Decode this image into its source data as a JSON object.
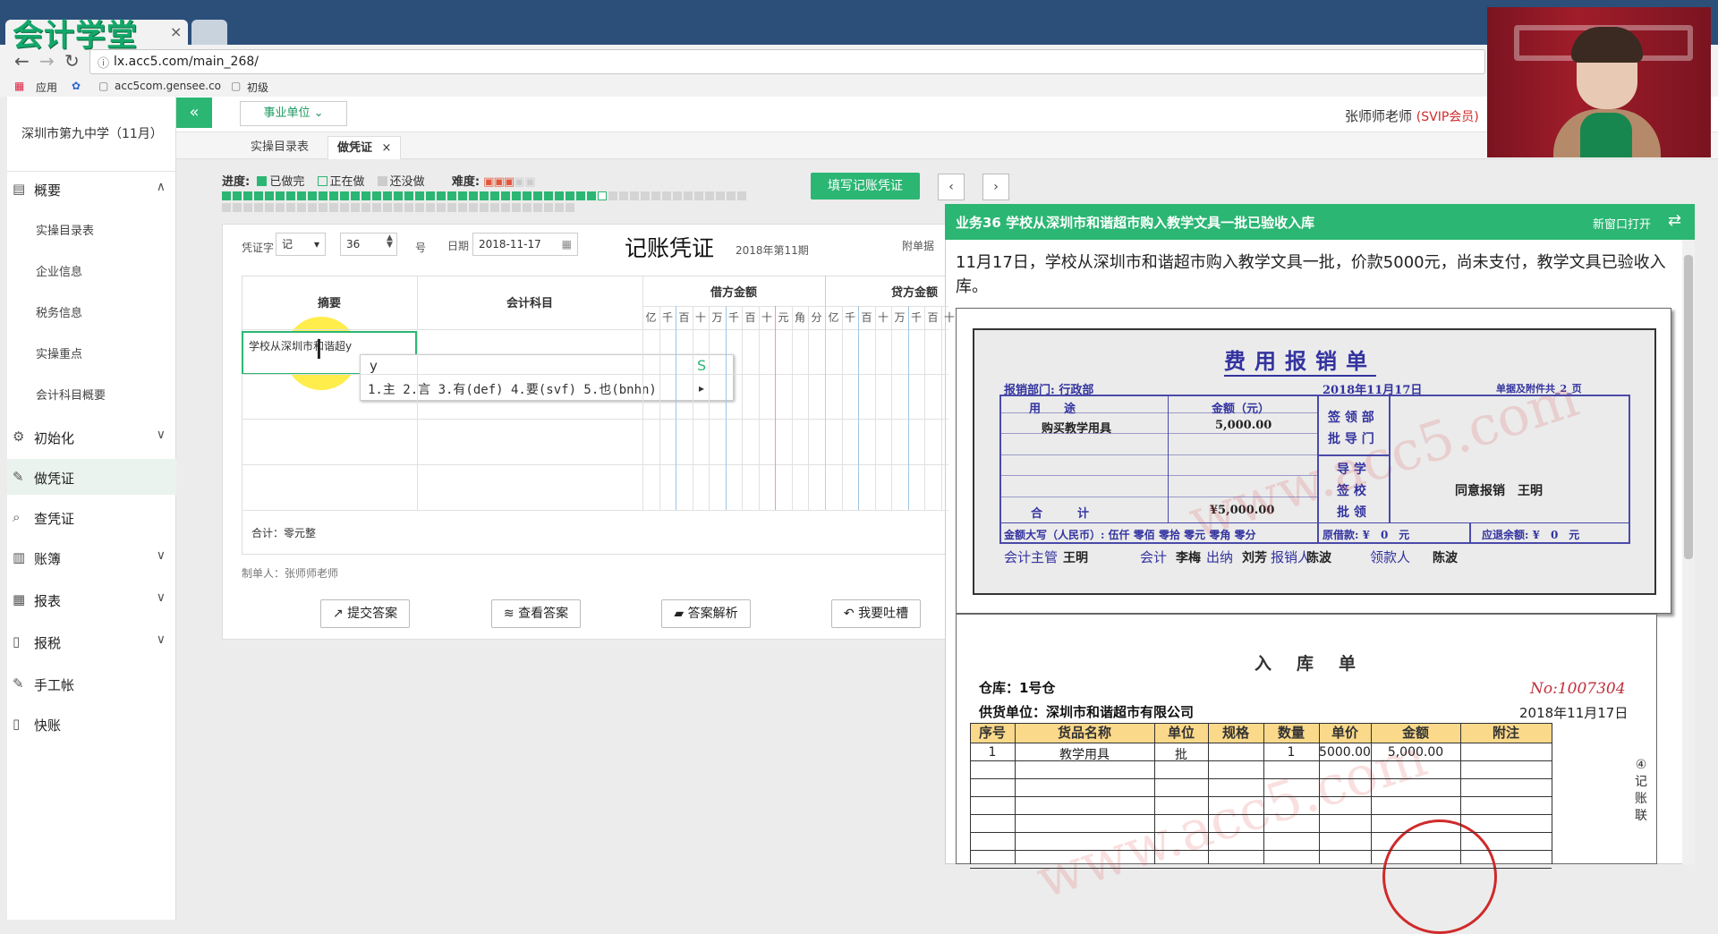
{
  "browser": {
    "tab_title": "会计学堂",
    "url": "lx.acc5.com/main_268/",
    "bookmarks": [
      "应用",
      "acc5com.gensee.co",
      "初级"
    ]
  },
  "header": {
    "unit_select": "事业单位",
    "teacher": "张师师老师",
    "member": "(SVIP会员)"
  },
  "sidebar": {
    "school": "深圳市第九中学（11月）",
    "items": [
      {
        "label": "概要",
        "icon": "grid-icon"
      },
      {
        "label": "实操目录表"
      },
      {
        "label": "企业信息"
      },
      {
        "label": "税务信息"
      },
      {
        "label": "实操重点"
      },
      {
        "label": "会计科目概要"
      },
      {
        "label": "初始化",
        "icon": "gear-icon"
      },
      {
        "label": "做凭证",
        "icon": "pencil-icon"
      },
      {
        "label": "查凭证",
        "icon": "search-icon"
      },
      {
        "label": "账簿",
        "icon": "book-icon"
      },
      {
        "label": "报表",
        "icon": "report-icon"
      },
      {
        "label": "报税",
        "icon": "file-icon"
      },
      {
        "label": "手工帐",
        "icon": "pencil-icon"
      },
      {
        "label": "快账",
        "icon": "file-icon"
      }
    ]
  },
  "tabs": [
    "实操目录表",
    "做凭证"
  ],
  "progress": {
    "label": "进度:",
    "done": "已做完",
    "doing": "正在做",
    "todo": "还没做",
    "difficulty": "难度:",
    "done_count": 35,
    "total": 82,
    "current_index": 35
  },
  "fill_button": "填写记账凭证",
  "voucher": {
    "type_label": "凭证字",
    "type_value": "记",
    "number": "36",
    "number_suffix": "号",
    "date_label": "日期",
    "date": "2018-11-17",
    "title": "记账凭证",
    "period": "2018年第11期",
    "attach_label": "附单据",
    "col_summary": "摘要",
    "col_account": "会计科目",
    "col_debit": "借方金额",
    "col_credit": "贷方金额",
    "digits": [
      "亿",
      "千",
      "百",
      "十",
      "万",
      "千",
      "百",
      "十",
      "元",
      "角",
      "分"
    ],
    "summary_input": "学校从深圳市和谐超y",
    "total": "合计：零元整",
    "maker": "制单人：张师师老师"
  },
  "ime": {
    "input": "y",
    "candidates": "1.主  2.言  3.有(def)  4.要(svf)  5.也(bnhn)"
  },
  "actions": [
    "提交答案",
    "查看答案",
    "答案解析",
    "我要吐槽"
  ],
  "panel": {
    "title": "业务36 学校从深圳市和谐超市购入教学文具一批已验收入库",
    "new_window": "新窗口打开",
    "description": "11月17日，学校从深圳市和谐超市购入教学文具一批，价款5000元，尚未支付，教学文具已验收入库。"
  },
  "receipt1": {
    "title": "费用报销单",
    "dept": "报销部门: 行政部",
    "date": "2018年11月17日",
    "attach": "单据及附件共_2_页",
    "col_use": "用　　途",
    "col_amount": "金额（元）",
    "item": "购买教学用具",
    "item_amount": "5,000.00",
    "approve1": "签 领 部",
    "approve1b": "批 导 门",
    "approve2a": "导 学",
    "approve2b": "签 校",
    "approve2c": "批 领",
    "approval": "同意报销　王明",
    "total_label": "合　　　计",
    "total": "¥5,000.00",
    "upper": "金额大写（人民币）: 伍仟 零佰 零拾 零元 零角 零分",
    "borrow": "原借款: ¥　0　元",
    "refund": "应退余额: ¥　0　元",
    "signers": [
      {
        "role": "会计主管",
        "name": "王明"
      },
      {
        "role": "会计",
        "name": "李梅"
      },
      {
        "role": "出纳",
        "name": "刘芳"
      },
      {
        "role": "报销人",
        "name": "陈波"
      },
      {
        "role": "领款人",
        "name": "陈波"
      }
    ]
  },
  "receipt2": {
    "title": "入库单",
    "warehouse": "仓库：1号仓",
    "supplier": "供货单位：深圳市和谐超市有限公司",
    "no": "No:1007304",
    "date": "2018年11月17日",
    "headers": [
      "序号",
      "货品名称",
      "单位",
      "规格",
      "数量",
      "单价",
      "金额",
      "附注"
    ],
    "row": [
      "1",
      "教学用具",
      "批",
      "",
      "1",
      "5000.00",
      "5,000.00",
      ""
    ],
    "side": "④记账联"
  },
  "watermark": "www.acc5.com",
  "colors": {
    "accent": "#2bb673",
    "receipt_ink": "#3333a0",
    "stamp": "#d02a2a"
  }
}
